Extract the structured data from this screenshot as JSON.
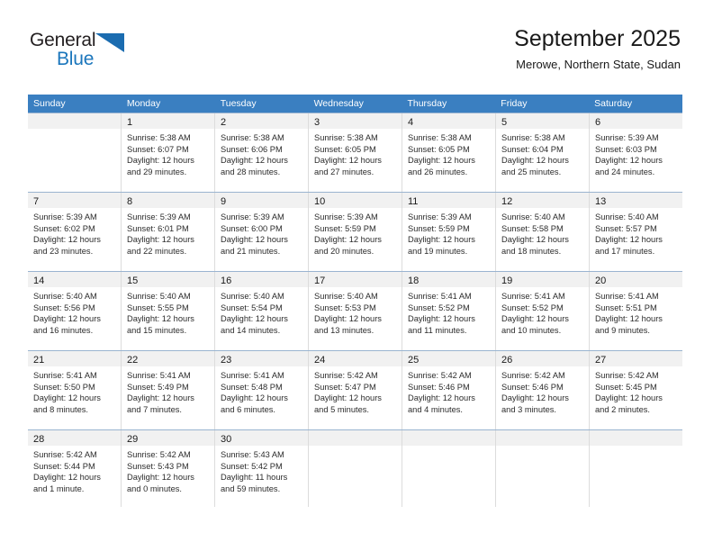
{
  "brand": {
    "name_part1": "General",
    "name_part2": "Blue",
    "accent_color": "#1b6cb0"
  },
  "header": {
    "title": "September 2025",
    "subtitle": "Merowe, Northern State, Sudan"
  },
  "calendar": {
    "header_bg": "#3a7fc1",
    "weekdays": [
      "Sunday",
      "Monday",
      "Tuesday",
      "Wednesday",
      "Thursday",
      "Friday",
      "Saturday"
    ],
    "weeks": [
      [
        {
          "day": "",
          "sunrise": "",
          "sunset": "",
          "daylight_line1": "",
          "daylight_line2": ""
        },
        {
          "day": "1",
          "sunrise": "Sunrise: 5:38 AM",
          "sunset": "Sunset: 6:07 PM",
          "daylight_line1": "Daylight: 12 hours",
          "daylight_line2": "and 29 minutes."
        },
        {
          "day": "2",
          "sunrise": "Sunrise: 5:38 AM",
          "sunset": "Sunset: 6:06 PM",
          "daylight_line1": "Daylight: 12 hours",
          "daylight_line2": "and 28 minutes."
        },
        {
          "day": "3",
          "sunrise": "Sunrise: 5:38 AM",
          "sunset": "Sunset: 6:05 PM",
          "daylight_line1": "Daylight: 12 hours",
          "daylight_line2": "and 27 minutes."
        },
        {
          "day": "4",
          "sunrise": "Sunrise: 5:38 AM",
          "sunset": "Sunset: 6:05 PM",
          "daylight_line1": "Daylight: 12 hours",
          "daylight_line2": "and 26 minutes."
        },
        {
          "day": "5",
          "sunrise": "Sunrise: 5:38 AM",
          "sunset": "Sunset: 6:04 PM",
          "daylight_line1": "Daylight: 12 hours",
          "daylight_line2": "and 25 minutes."
        },
        {
          "day": "6",
          "sunrise": "Sunrise: 5:39 AM",
          "sunset": "Sunset: 6:03 PM",
          "daylight_line1": "Daylight: 12 hours",
          "daylight_line2": "and 24 minutes."
        }
      ],
      [
        {
          "day": "7",
          "sunrise": "Sunrise: 5:39 AM",
          "sunset": "Sunset: 6:02 PM",
          "daylight_line1": "Daylight: 12 hours",
          "daylight_line2": "and 23 minutes."
        },
        {
          "day": "8",
          "sunrise": "Sunrise: 5:39 AM",
          "sunset": "Sunset: 6:01 PM",
          "daylight_line1": "Daylight: 12 hours",
          "daylight_line2": "and 22 minutes."
        },
        {
          "day": "9",
          "sunrise": "Sunrise: 5:39 AM",
          "sunset": "Sunset: 6:00 PM",
          "daylight_line1": "Daylight: 12 hours",
          "daylight_line2": "and 21 minutes."
        },
        {
          "day": "10",
          "sunrise": "Sunrise: 5:39 AM",
          "sunset": "Sunset: 5:59 PM",
          "daylight_line1": "Daylight: 12 hours",
          "daylight_line2": "and 20 minutes."
        },
        {
          "day": "11",
          "sunrise": "Sunrise: 5:39 AM",
          "sunset": "Sunset: 5:59 PM",
          "daylight_line1": "Daylight: 12 hours",
          "daylight_line2": "and 19 minutes."
        },
        {
          "day": "12",
          "sunrise": "Sunrise: 5:40 AM",
          "sunset": "Sunset: 5:58 PM",
          "daylight_line1": "Daylight: 12 hours",
          "daylight_line2": "and 18 minutes."
        },
        {
          "day": "13",
          "sunrise": "Sunrise: 5:40 AM",
          "sunset": "Sunset: 5:57 PM",
          "daylight_line1": "Daylight: 12 hours",
          "daylight_line2": "and 17 minutes."
        }
      ],
      [
        {
          "day": "14",
          "sunrise": "Sunrise: 5:40 AM",
          "sunset": "Sunset: 5:56 PM",
          "daylight_line1": "Daylight: 12 hours",
          "daylight_line2": "and 16 minutes."
        },
        {
          "day": "15",
          "sunrise": "Sunrise: 5:40 AM",
          "sunset": "Sunset: 5:55 PM",
          "daylight_line1": "Daylight: 12 hours",
          "daylight_line2": "and 15 minutes."
        },
        {
          "day": "16",
          "sunrise": "Sunrise: 5:40 AM",
          "sunset": "Sunset: 5:54 PM",
          "daylight_line1": "Daylight: 12 hours",
          "daylight_line2": "and 14 minutes."
        },
        {
          "day": "17",
          "sunrise": "Sunrise: 5:40 AM",
          "sunset": "Sunset: 5:53 PM",
          "daylight_line1": "Daylight: 12 hours",
          "daylight_line2": "and 13 minutes."
        },
        {
          "day": "18",
          "sunrise": "Sunrise: 5:41 AM",
          "sunset": "Sunset: 5:52 PM",
          "daylight_line1": "Daylight: 12 hours",
          "daylight_line2": "and 11 minutes."
        },
        {
          "day": "19",
          "sunrise": "Sunrise: 5:41 AM",
          "sunset": "Sunset: 5:52 PM",
          "daylight_line1": "Daylight: 12 hours",
          "daylight_line2": "and 10 minutes."
        },
        {
          "day": "20",
          "sunrise": "Sunrise: 5:41 AM",
          "sunset": "Sunset: 5:51 PM",
          "daylight_line1": "Daylight: 12 hours",
          "daylight_line2": "and 9 minutes."
        }
      ],
      [
        {
          "day": "21",
          "sunrise": "Sunrise: 5:41 AM",
          "sunset": "Sunset: 5:50 PM",
          "daylight_line1": "Daylight: 12 hours",
          "daylight_line2": "and 8 minutes."
        },
        {
          "day": "22",
          "sunrise": "Sunrise: 5:41 AM",
          "sunset": "Sunset: 5:49 PM",
          "daylight_line1": "Daylight: 12 hours",
          "daylight_line2": "and 7 minutes."
        },
        {
          "day": "23",
          "sunrise": "Sunrise: 5:41 AM",
          "sunset": "Sunset: 5:48 PM",
          "daylight_line1": "Daylight: 12 hours",
          "daylight_line2": "and 6 minutes."
        },
        {
          "day": "24",
          "sunrise": "Sunrise: 5:42 AM",
          "sunset": "Sunset: 5:47 PM",
          "daylight_line1": "Daylight: 12 hours",
          "daylight_line2": "and 5 minutes."
        },
        {
          "day": "25",
          "sunrise": "Sunrise: 5:42 AM",
          "sunset": "Sunset: 5:46 PM",
          "daylight_line1": "Daylight: 12 hours",
          "daylight_line2": "and 4 minutes."
        },
        {
          "day": "26",
          "sunrise": "Sunrise: 5:42 AM",
          "sunset": "Sunset: 5:46 PM",
          "daylight_line1": "Daylight: 12 hours",
          "daylight_line2": "and 3 minutes."
        },
        {
          "day": "27",
          "sunrise": "Sunrise: 5:42 AM",
          "sunset": "Sunset: 5:45 PM",
          "daylight_line1": "Daylight: 12 hours",
          "daylight_line2": "and 2 minutes."
        }
      ],
      [
        {
          "day": "28",
          "sunrise": "Sunrise: 5:42 AM",
          "sunset": "Sunset: 5:44 PM",
          "daylight_line1": "Daylight: 12 hours",
          "daylight_line2": "and 1 minute."
        },
        {
          "day": "29",
          "sunrise": "Sunrise: 5:42 AM",
          "sunset": "Sunset: 5:43 PM",
          "daylight_line1": "Daylight: 12 hours",
          "daylight_line2": "and 0 minutes."
        },
        {
          "day": "30",
          "sunrise": "Sunrise: 5:43 AM",
          "sunset": "Sunset: 5:42 PM",
          "daylight_line1": "Daylight: 11 hours",
          "daylight_line2": "and 59 minutes."
        },
        {
          "day": "",
          "sunrise": "",
          "sunset": "",
          "daylight_line1": "",
          "daylight_line2": ""
        },
        {
          "day": "",
          "sunrise": "",
          "sunset": "",
          "daylight_line1": "",
          "daylight_line2": ""
        },
        {
          "day": "",
          "sunrise": "",
          "sunset": "",
          "daylight_line1": "",
          "daylight_line2": ""
        },
        {
          "day": "",
          "sunrise": "",
          "sunset": "",
          "daylight_line1": "",
          "daylight_line2": ""
        }
      ]
    ]
  }
}
